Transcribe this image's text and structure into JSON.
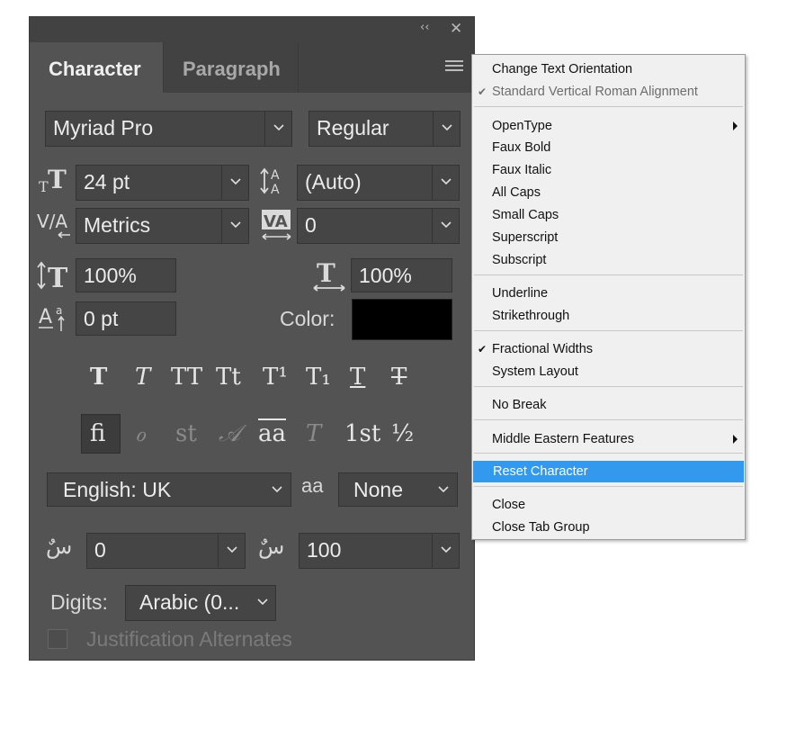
{
  "panel": {
    "collapse_icon": "double-chevron-left-icon",
    "close_icon": "close-icon",
    "tabs": [
      {
        "label": "Character",
        "active": true
      },
      {
        "label": "Paragraph",
        "active": false
      }
    ],
    "menu_icon": "hamburger-menu-icon"
  },
  "font_family": "Myriad Pro",
  "font_style": "Regular",
  "font_size": "24 pt",
  "leading": "(Auto)",
  "kerning": "Metrics",
  "tracking": "0",
  "vertical_scale": "100%",
  "horizontal_scale": "100%",
  "baseline_shift": "0 pt",
  "color": {
    "label": "Color:",
    "value": "#000000"
  },
  "type_styles": [
    "T",
    "T",
    "TT",
    "Tt",
    "T¹",
    "T₁",
    "T",
    "T"
  ],
  "opentype_features": [
    {
      "glyph": "fi",
      "active": true
    },
    {
      "glyph": "ℴ",
      "active": false
    },
    {
      "glyph": "st",
      "active": false
    },
    {
      "glyph": "𝒜",
      "active": false
    },
    {
      "glyph": "aa",
      "active": true
    },
    {
      "glyph": "T",
      "active": false
    },
    {
      "glyph": "1st",
      "active": true
    },
    {
      "glyph": "½",
      "active": true
    }
  ],
  "language": "English: UK",
  "antialias_icon": "aa",
  "antialias": "None",
  "middle_eastern": {
    "kashida_width": "0",
    "diacritic_position": "100",
    "kashida_glyph": "سٌ"
  },
  "digits": {
    "label": "Digits:",
    "value": "Arabic (0..."
  },
  "justification_alternates": {
    "label": "Justification Alternates",
    "checked": false
  },
  "context_menu": {
    "items": [
      {
        "label": "Change Text Orientation"
      },
      {
        "label": "Standard Vertical Roman Alignment",
        "checked": true,
        "disabled": true
      },
      {
        "label": "OpenType",
        "submenu": true
      },
      {
        "label": "Faux Bold"
      },
      {
        "label": "Faux Italic"
      },
      {
        "label": "All Caps"
      },
      {
        "label": "Small Caps"
      },
      {
        "label": "Superscript"
      },
      {
        "label": "Subscript"
      },
      {
        "label": "Underline"
      },
      {
        "label": "Strikethrough"
      },
      {
        "label": "Fractional Widths",
        "checked": true
      },
      {
        "label": "System Layout"
      },
      {
        "label": "No Break"
      },
      {
        "label": "Middle Eastern Features",
        "submenu": true
      },
      {
        "label": "Reset Character",
        "highlighted": true
      },
      {
        "label": "Close"
      },
      {
        "label": "Close Tab Group"
      }
    ],
    "check_glyph": "✔",
    "highlight_color": "#3399ee"
  }
}
